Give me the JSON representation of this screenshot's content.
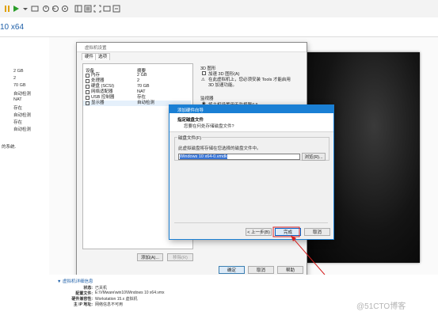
{
  "tab": {
    "title": "10 x64"
  },
  "left_values": [
    "2 GB",
    "2",
    "70 GB",
    "自动检测",
    "NAT",
    "存在",
    "自动检测",
    "存在",
    "自动检测"
  ],
  "left_note": "的系统.",
  "settings": {
    "title": "虚拟机设置",
    "tabs": [
      "硬件",
      "选项"
    ],
    "columns": [
      "设备",
      "摘要"
    ],
    "devices": [
      {
        "name": "内存",
        "summary": "2 GB",
        "icon": "memory-icon"
      },
      {
        "name": "处理器",
        "summary": "2",
        "icon": "cpu-icon"
      },
      {
        "name": "硬盘 (SCSI)",
        "summary": "70 GB",
        "icon": "disk-icon"
      },
      {
        "name": "网络适配器",
        "summary": "NAT",
        "icon": "network-icon"
      },
      {
        "name": "USB 控制器",
        "summary": "存在",
        "icon": "usb-icon"
      },
      {
        "name": "显示器",
        "summary": "自动检测",
        "icon": "monitor-icon"
      }
    ],
    "add_button": "添加(A)...",
    "remove_button": "移除(R)",
    "ok_button": "确定",
    "cancel_button": "取消",
    "help_button": "帮助",
    "right": {
      "group_3d": "3D 图形",
      "accel_3d": "加速 3D 图形(A)",
      "tools_note": "在此虚拟机上，您必须安装 Tools 才能启用 3D 加速功能。",
      "monitor_group": "监视器",
      "monitor_option": "将主机设置用于监视器(U)"
    }
  },
  "wizard": {
    "title": "添加硬件向导",
    "step": "指定磁盘文件",
    "question": "您要在何处存储磁盘文件?",
    "group_label": "磁盘文件(F)",
    "description": "此虚拟磁盘将存储在您选择的磁盘文件中。",
    "file_value": "Windows 10 x64-0.vmdk",
    "browse_button": "浏览(R)...",
    "back_button": "< 上一步(B)",
    "finish_button": "完成",
    "cancel_button": "取消"
  },
  "details": {
    "title": "▼ 虚拟机详细信息",
    "rows": [
      {
        "label": "状态:",
        "value": "已关机"
      },
      {
        "label": "配置文件:",
        "value": "E:\\VMware\\win10\\Windows 10 x64.vmx"
      },
      {
        "label": "硬件兼容性:",
        "value": "Workstation 15.x 虚拟机"
      },
      {
        "label": "主 IP 地址:",
        "value": "网络信息不可用"
      }
    ]
  },
  "watermark": "@51CTO博客"
}
